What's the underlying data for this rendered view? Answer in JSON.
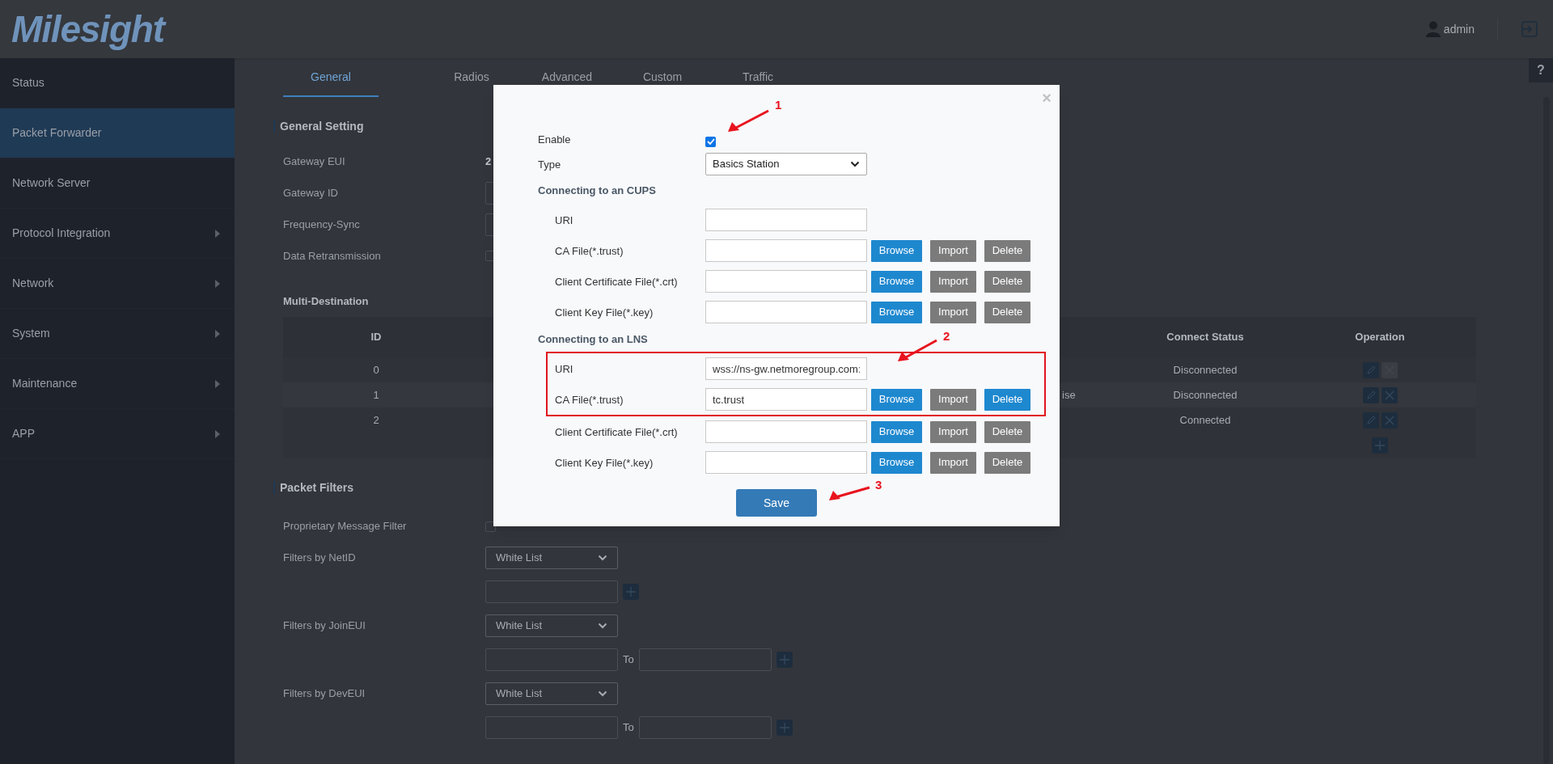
{
  "header": {
    "logo": "Milesight",
    "user": "admin"
  },
  "help": "?",
  "sidebar": {
    "items": [
      {
        "label": "Status",
        "selected": false,
        "has_submenu": false
      },
      {
        "label": "Packet Forwarder",
        "selected": true,
        "has_submenu": false
      },
      {
        "label": "Network Server",
        "selected": false,
        "has_submenu": false
      },
      {
        "label": "Protocol Integration",
        "selected": false,
        "has_submenu": true
      },
      {
        "label": "Network",
        "selected": false,
        "has_submenu": true
      },
      {
        "label": "System",
        "selected": false,
        "has_submenu": true
      },
      {
        "label": "Maintenance",
        "selected": false,
        "has_submenu": true
      },
      {
        "label": "APP",
        "selected": false,
        "has_submenu": true
      }
    ]
  },
  "tabs": [
    {
      "label": "General",
      "selected": true
    },
    {
      "label": "Radios",
      "selected": false
    },
    {
      "label": "Advanced",
      "selected": false
    },
    {
      "label": "Custom",
      "selected": false
    },
    {
      "label": "Traffic",
      "selected": false
    }
  ],
  "general_setting": {
    "title": "General Setting",
    "fields": [
      {
        "label": "Gateway EUI",
        "kind": "text",
        "value": "2"
      },
      {
        "label": "Gateway ID",
        "kind": "input"
      },
      {
        "label": "Frequency-Sync",
        "kind": "input"
      },
      {
        "label": "Data Retransmission",
        "kind": "checkbox",
        "checked": false
      }
    ]
  },
  "multi_destination": {
    "title": "Multi-Destination",
    "columns": [
      "ID",
      "Connect Status",
      "Operation"
    ],
    "rows": [
      {
        "id": "0",
        "status": "Disconnected",
        "delete_disabled": true
      },
      {
        "id": "1",
        "column_3": "ise",
        "status": "Disconnected",
        "delete_disabled": false
      },
      {
        "id": "2",
        "status": "Connected",
        "delete_disabled": false
      }
    ]
  },
  "packet_filters": {
    "title": "Packet Filters",
    "proprietary": {
      "label": "Proprietary Message Filter",
      "checked": false
    },
    "filters": [
      {
        "label": "Filters by NetID",
        "mode": "White List"
      },
      {
        "label": "Filters by JoinEUI",
        "mode": "White List",
        "to": "To"
      },
      {
        "label": "Filters by DevEUI",
        "mode": "White List",
        "to": "To"
      }
    ]
  },
  "modal": {
    "close": "×",
    "enable": {
      "label": "Enable",
      "checked": true
    },
    "type": {
      "label": "Type",
      "value": "Basics Station"
    },
    "sections": [
      {
        "title": "Connecting to an CUPS",
        "rows": [
          {
            "label": "URI",
            "kind": "uri",
            "highlighted": false
          },
          {
            "label": "CA File(*.trust)",
            "kind": "file",
            "highlighted": false,
            "buttons": [
              {
                "label": "Browse",
                "kind": "primary"
              },
              {
                "label": "Import",
                "kind": "secondary"
              },
              {
                "label": "Delete",
                "kind": "secondary"
              }
            ]
          },
          {
            "label": "Client Certificate File(*.crt)",
            "kind": "file",
            "highlighted": false,
            "buttons": [
              {
                "label": "Browse",
                "kind": "primary"
              },
              {
                "label": "Import",
                "kind": "secondary"
              },
              {
                "label": "Delete",
                "kind": "secondary"
              }
            ]
          },
          {
            "label": "Client Key File(*.key)",
            "kind": "file",
            "highlighted": false,
            "buttons": [
              {
                "label": "Browse",
                "kind": "primary"
              },
              {
                "label": "Import",
                "kind": "secondary"
              },
              {
                "label": "Delete",
                "kind": "secondary"
              }
            ]
          }
        ]
      },
      {
        "title": "Connecting to an LNS",
        "rows": [
          {
            "label": "URI",
            "kind": "uri",
            "highlighted": true,
            "value": "wss://ns-gw.netmoregroup.com:"
          },
          {
            "label": "CA File(*.trust)",
            "kind": "file",
            "highlighted": true,
            "value": "tc.trust",
            "buttons": [
              {
                "label": "Browse",
                "kind": "primary"
              },
              {
                "label": "Import",
                "kind": "secondary"
              },
              {
                "label": "Delete",
                "kind": "primary"
              }
            ]
          },
          {
            "label": "Client Certificate File(*.crt)",
            "kind": "file",
            "highlighted": false,
            "buttons": [
              {
                "label": "Browse",
                "kind": "primary"
              },
              {
                "label": "Import",
                "kind": "secondary"
              },
              {
                "label": "Delete",
                "kind": "secondary"
              }
            ]
          },
          {
            "label": "Client Key File(*.key)",
            "kind": "file",
            "highlighted": false,
            "buttons": [
              {
                "label": "Browse",
                "kind": "primary"
              },
              {
                "label": "Import",
                "kind": "secondary"
              },
              {
                "label": "Delete",
                "kind": "secondary"
              }
            ]
          }
        ]
      }
    ],
    "save": "Save",
    "annotations": [
      {
        "number": "1"
      },
      {
        "number": "2"
      },
      {
        "number": "3"
      }
    ]
  }
}
